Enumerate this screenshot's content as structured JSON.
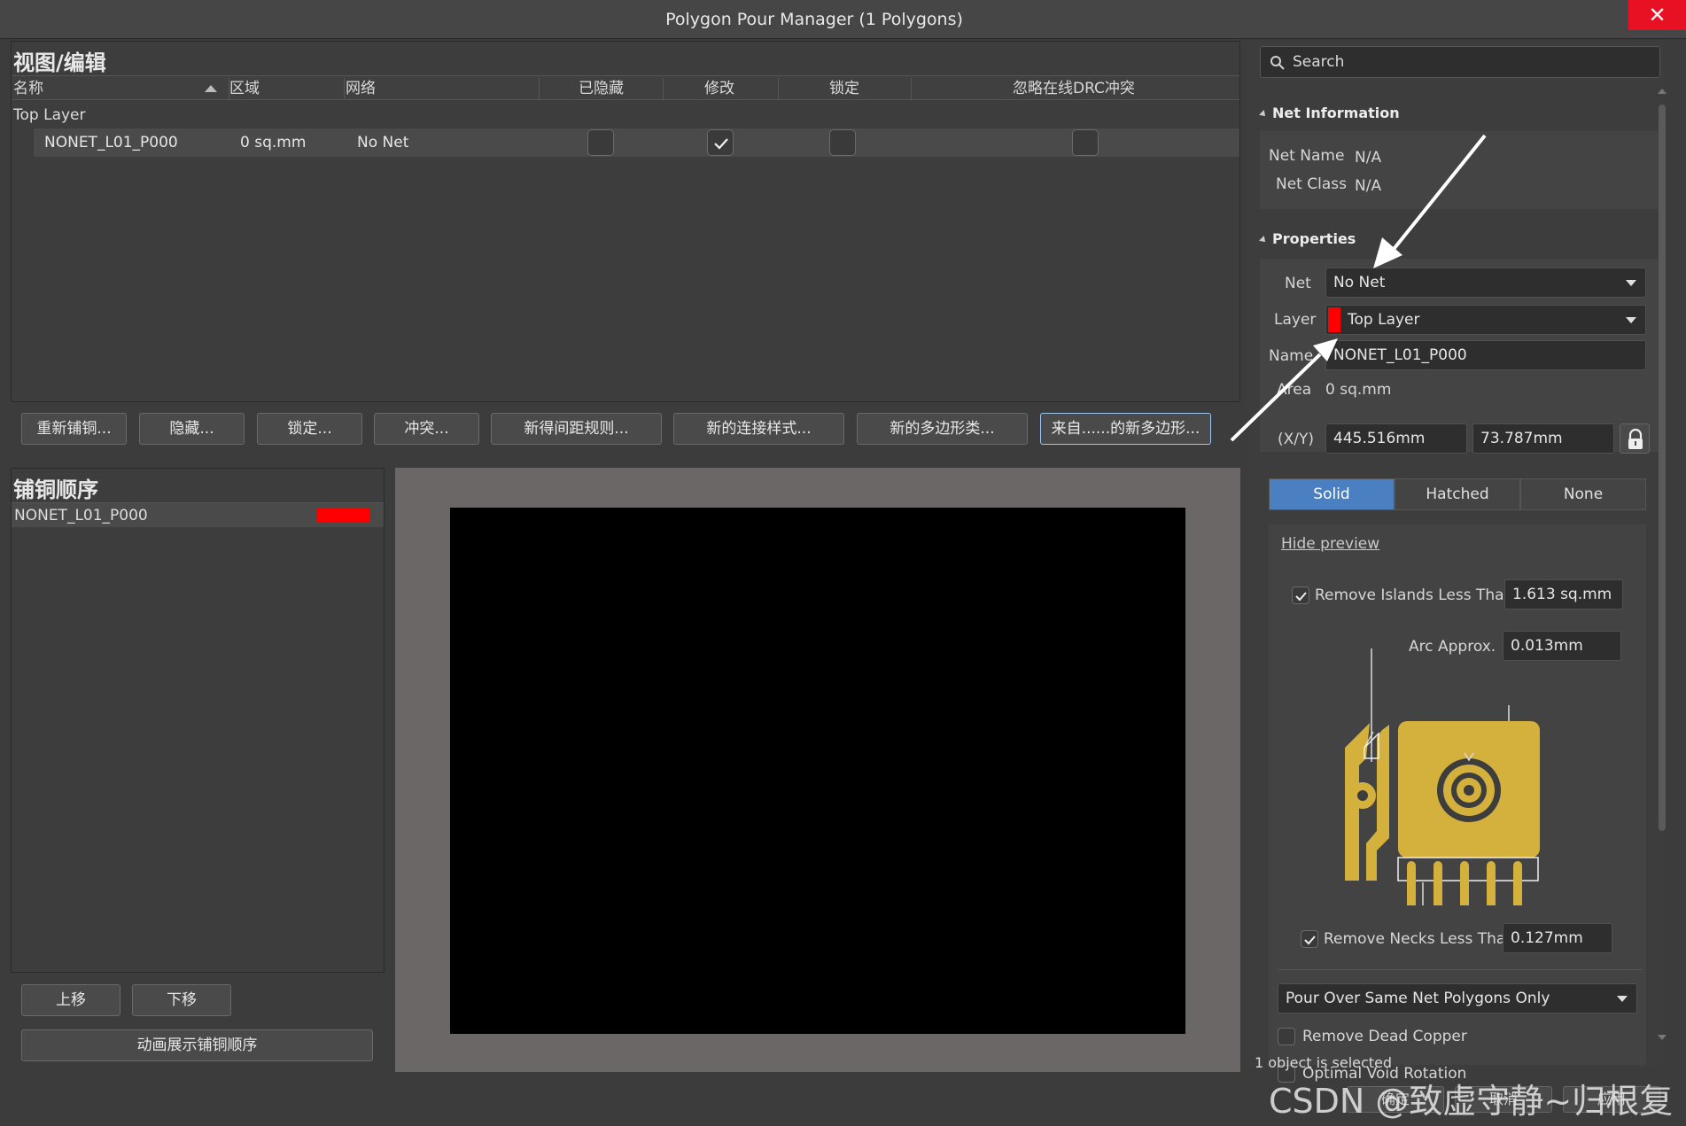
{
  "window": {
    "title": "Polygon Pour Manager (1 Polygons)",
    "close_glyph": "✕"
  },
  "view_edit": {
    "title": "视图/编辑",
    "columns": [
      "名称",
      "区域",
      "网络",
      "已隐藏",
      "修改",
      "锁定",
      "忽略在线DRC冲突"
    ],
    "group_label": "Top Layer",
    "row": {
      "name": "NONET_L01_P000",
      "area": "0 sq.mm",
      "net": "No Net",
      "hidden": false,
      "modified": true,
      "locked": false,
      "ignore_drc": false
    }
  },
  "actions": [
    "重新铺铜...",
    "隐藏...",
    "锁定...",
    "冲突...",
    "新得间距规则...",
    "新的连接样式...",
    "新的多边形类...",
    "来自......的新多边形..."
  ],
  "pour_order": {
    "title": "铺铜顺序",
    "item": "NONET_L01_P000",
    "item_color": "#ff0000",
    "move_up": "上移",
    "move_down": "下移",
    "animate": "动画展示铺铜顺序"
  },
  "properties_panel": {
    "search_placeholder": "Search",
    "net_info_title": "Net Information",
    "net_name_label": "Net Name",
    "net_name_value": "N/A",
    "net_class_label": "Net Class",
    "net_class_value": "N/A",
    "properties_title": "Properties",
    "net_label": "Net",
    "net_value": "No Net",
    "layer_label": "Layer",
    "layer_value": "Top Layer",
    "layer_color": "#ff0000",
    "name_label": "Name",
    "name_value": "NONET_L01_P000",
    "area_label": "Area",
    "area_value": "0 sq.mm",
    "xy_label": "(X/Y)",
    "x_value": "445.516mm",
    "y_value": "73.787mm",
    "fill_modes": [
      "Solid",
      "Hatched",
      "None"
    ],
    "fill_selected": "Solid",
    "hide_preview": "Hide preview",
    "remove_islands_label": "Remove Islands Less Than",
    "remove_islands_checked": true,
    "remove_islands_value": "1.613 sq.mm",
    "arc_approx_label": "Arc Approx.",
    "arc_approx_value": "0.013mm",
    "remove_necks_label": "Remove Necks Less Than",
    "remove_necks_checked": true,
    "remove_necks_value": "0.127mm",
    "pour_over_value": "Pour Over Same Net Polygons Only",
    "remove_dead_copper_label": "Remove Dead Copper",
    "remove_dead_copper_checked": false,
    "optimal_void_label": "Optimal Void Rotation",
    "optimal_void_checked": false
  },
  "status_text": "1 object is selected",
  "dialog_buttons": [
    "确定",
    "取消",
    "应用"
  ],
  "watermark": "CSDN @致虚守静~归根复命",
  "colors": {
    "accent_blue": "#4a7fc1",
    "copper_gold": "#d4b13c",
    "close_red": "#e81123"
  }
}
